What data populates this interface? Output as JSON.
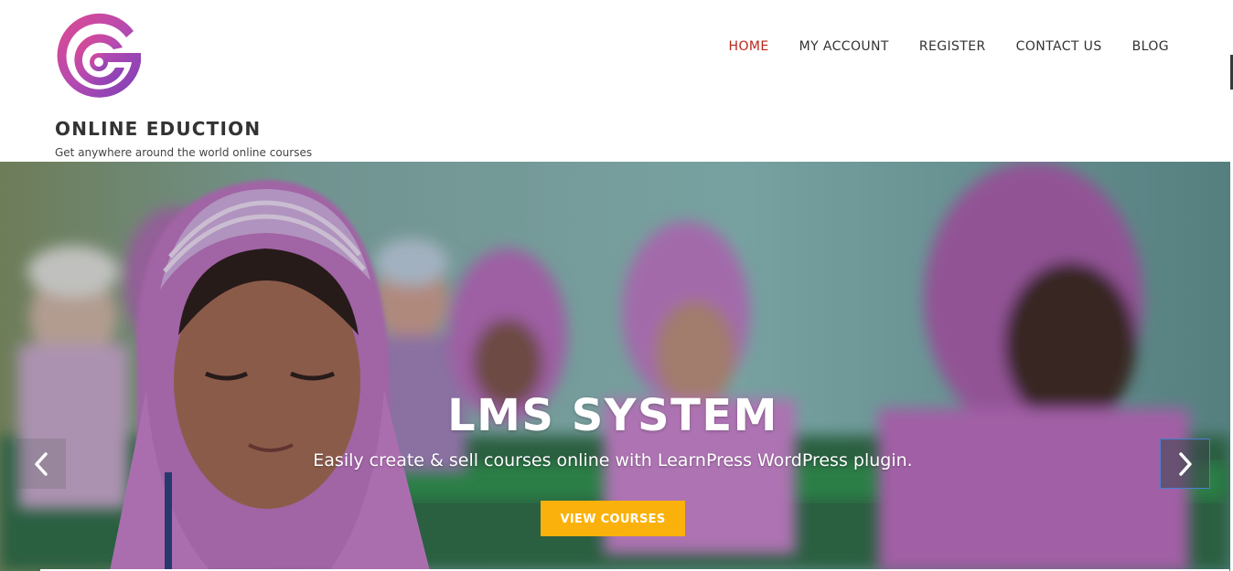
{
  "header": {
    "site_title": "ONLINE EDUCTION",
    "tagline": "Get anywhere around the world online courses",
    "logo_icon": "g-logo-icon"
  },
  "nav": {
    "items": [
      {
        "label": "HOME",
        "active": true
      },
      {
        "label": "MY ACCOUNT",
        "active": false
      },
      {
        "label": "REGISTER",
        "active": false
      },
      {
        "label": "CONTACT US",
        "active": false
      },
      {
        "label": "BLOG",
        "active": false
      }
    ],
    "active_color": "#b7271a",
    "text_color": "#333333"
  },
  "hero": {
    "title": "LMS SYSTEM",
    "subtitle": "Easily create & sell courses online with LearnPress WordPress plugin.",
    "cta_label": "VIEW COURSES",
    "cta_color": "#fbb10b",
    "prev_icon": "chevron-left-icon",
    "next_icon": "chevron-right-icon"
  }
}
